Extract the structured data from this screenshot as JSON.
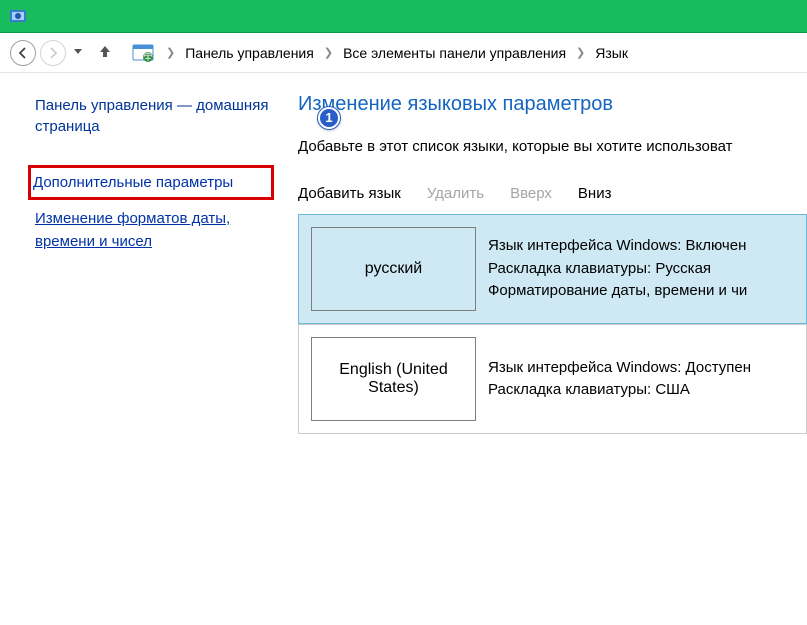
{
  "breadcrumb": {
    "items": [
      "Панель управления",
      "Все элементы панели управления",
      "Язык"
    ]
  },
  "sidebar": {
    "home": "Панель управления — домашняя страница",
    "badge": "1",
    "additional": "Дополнительные параметры",
    "formats": "Изменение форматов даты, времени и чисел"
  },
  "main": {
    "title": "Изменение языковых параметров",
    "description": "Добавьте в этот список языки, которые вы хотите использоват"
  },
  "toolbar": {
    "add": "Добавить язык",
    "remove": "Удалить",
    "up": "Вверх",
    "down": "Вниз"
  },
  "languages": [
    {
      "name": "русский",
      "selected": true,
      "details": "Язык интерфейса Windows: Включен\nРаскладка клавиатуры: Русская\nФорматирование даты, времени и чи"
    },
    {
      "name": "English (United States)",
      "selected": false,
      "details": "Язык интерфейса Windows: Доступен\nРаскладка клавиатуры: США"
    }
  ]
}
